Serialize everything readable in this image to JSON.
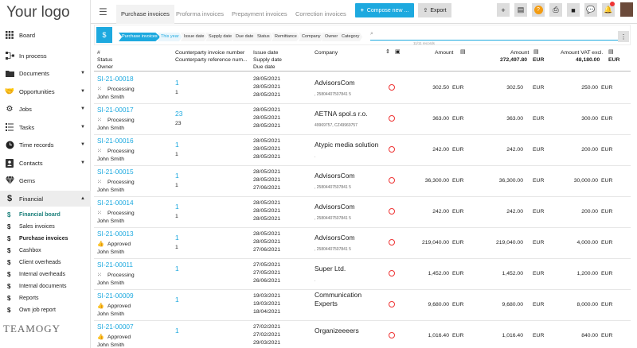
{
  "logo": "Your logo",
  "sidebar": {
    "items": [
      {
        "label": "Board",
        "icon": "grid-icon"
      },
      {
        "label": "In process",
        "icon": "flow-icon"
      },
      {
        "label": "Documents",
        "icon": "folder-icon"
      },
      {
        "label": "Opportunities",
        "icon": "handshake-icon"
      },
      {
        "label": "Jobs",
        "icon": "gears-icon"
      },
      {
        "label": "Tasks",
        "icon": "tasks-icon"
      },
      {
        "label": "Time records",
        "icon": "clock-icon"
      },
      {
        "label": "Contacts",
        "icon": "contact-icon"
      },
      {
        "label": "Gems",
        "icon": "gem-icon"
      },
      {
        "label": "Financial",
        "icon": "dollar-icon"
      }
    ],
    "financial_sub": [
      {
        "label": "Financial board"
      },
      {
        "label": "Sales invoices"
      },
      {
        "label": "Purchase invoices"
      },
      {
        "label": "Cashbox"
      },
      {
        "label": "Client overheads"
      },
      {
        "label": "Internal overheads"
      },
      {
        "label": "Internal documents"
      },
      {
        "label": "Reports"
      },
      {
        "label": "Own job report"
      }
    ],
    "brand": "TEAMOGY"
  },
  "topbar": {
    "tabs": [
      "Purchase invoices",
      "Proforma invoices",
      "Prepayment invoices",
      "Correction invoices"
    ],
    "compose_label": "Compose new ...",
    "export_label": "Export"
  },
  "filter": {
    "chips": [
      "Purchase invoices",
      "This year",
      "Issue date",
      "Supply date",
      "Due date",
      "Status",
      "Remittance",
      "Company",
      "Owner",
      "Category"
    ],
    "records": "11/11 records"
  },
  "headers": {
    "col1": [
      "#",
      "Status",
      "Owner"
    ],
    "col2": [
      "Counterparty invoice number",
      "Counterparty reference num..."
    ],
    "col3": [
      "Issue date",
      "Supply date",
      "Due date"
    ],
    "col4": "Company",
    "amount": "Amount",
    "amount_total": "272,497.80",
    "amount_total2": "272,497.80",
    "vat": "Amount VAT excl.",
    "vat_total": "48,180.00",
    "cur": "EUR"
  },
  "rows": [
    {
      "id": "SI-21-00018",
      "status": "Processing",
      "owner": "John Smith",
      "count": "1",
      "ref": "1",
      "d1": "28/05/2021",
      "d2": "28/05/2021",
      "d3": "28/05/2021",
      "company": "AdvisorsCom",
      "company2": "",
      "sub": ", 25804407507841 5",
      "a1": "302.50",
      "a2": "302.50",
      "a3": "250.00"
    },
    {
      "id": "SI-21-00017",
      "status": "Processing",
      "owner": "John Smith",
      "count": "23",
      "ref": "23",
      "d1": "28/05/2021",
      "d2": "28/05/2021",
      "d3": "28/05/2021",
      "company": "AETNA spol.s r.o.",
      "company2": "",
      "sub": "49969757, CZ49969757",
      "a1": "363.00",
      "a2": "363.00",
      "a3": "300.00"
    },
    {
      "id": "SI-21-00016",
      "status": "Processing",
      "owner": "John Smith",
      "count": "1",
      "ref": "1",
      "d1": "28/05/2021",
      "d2": "28/05/2021",
      "d3": "28/05/2021",
      "company": "Atypic media solution",
      "company2": "",
      "sub": ".",
      "a1": "242.00",
      "a2": "242.00",
      "a3": "200.00"
    },
    {
      "id": "SI-21-00015",
      "status": "Processing",
      "owner": "John Smith",
      "count": "1",
      "ref": "1",
      "d1": "28/05/2021",
      "d2": "28/05/2021",
      "d3": "27/06/2021",
      "company": "AdvisorsCom",
      "company2": "",
      "sub": ", 25804407507841 5",
      "a1": "36,300.00",
      "a2": "36,300.00",
      "a3": "30,000.00"
    },
    {
      "id": "SI-21-00014",
      "status": "Processing",
      "owner": "John Smith",
      "count": "1",
      "ref": "1",
      "d1": "28/05/2021",
      "d2": "28/05/2021",
      "d3": "28/05/2021",
      "company": "AdvisorsCom",
      "company2": "",
      "sub": ", 25804407507841 5",
      "a1": "242.00",
      "a2": "242.00",
      "a3": "200.00"
    },
    {
      "id": "SI-21-00013",
      "status": "Approved",
      "owner": "John Smith",
      "count": "1",
      "ref": "1",
      "d1": "28/05/2021",
      "d2": "28/05/2021",
      "d3": "27/06/2021",
      "company": "AdvisorsCom",
      "company2": "",
      "sub": ", 25804407507841 5",
      "a1": "219,040.00",
      "a2": "219,040.00",
      "a3": "4,000.00"
    },
    {
      "id": "SI-21-00011",
      "status": "Processing",
      "owner": "John Smith",
      "count": "1",
      "ref": "",
      "d1": "27/05/2021",
      "d2": "27/05/2021",
      "d3": "26/06/2021",
      "company": "Super Ltd.",
      "company2": "",
      "sub": ".",
      "a1": "1,452.00",
      "a2": "1,452.00",
      "a3": "1,200.00"
    },
    {
      "id": "SI-21-00009",
      "status": "Approved",
      "owner": "John Smith",
      "count": "1",
      "ref": "",
      "d1": "19/03/2021",
      "d2": "19/03/2021",
      "d3": "18/04/2021",
      "company": "Communication",
      "company2": "Experts",
      "sub": "",
      "a1": "9,680.00",
      "a2": "9,680.00",
      "a3": "8,000.00"
    },
    {
      "id": "SI-21-00007",
      "status": "Approved",
      "owner": "John Smith",
      "count": "1",
      "ref": "",
      "d1": "27/02/2021",
      "d2": "27/02/2021",
      "d3": "29/03/2021",
      "company": "Organizeeeers",
      "company2": "",
      "sub": "",
      "a1": "1,016.40",
      "a2": "1,016.40",
      "a3": "840.00"
    }
  ],
  "colors": {
    "accent": "#1da9df",
    "status_circle": "#e33333"
  }
}
